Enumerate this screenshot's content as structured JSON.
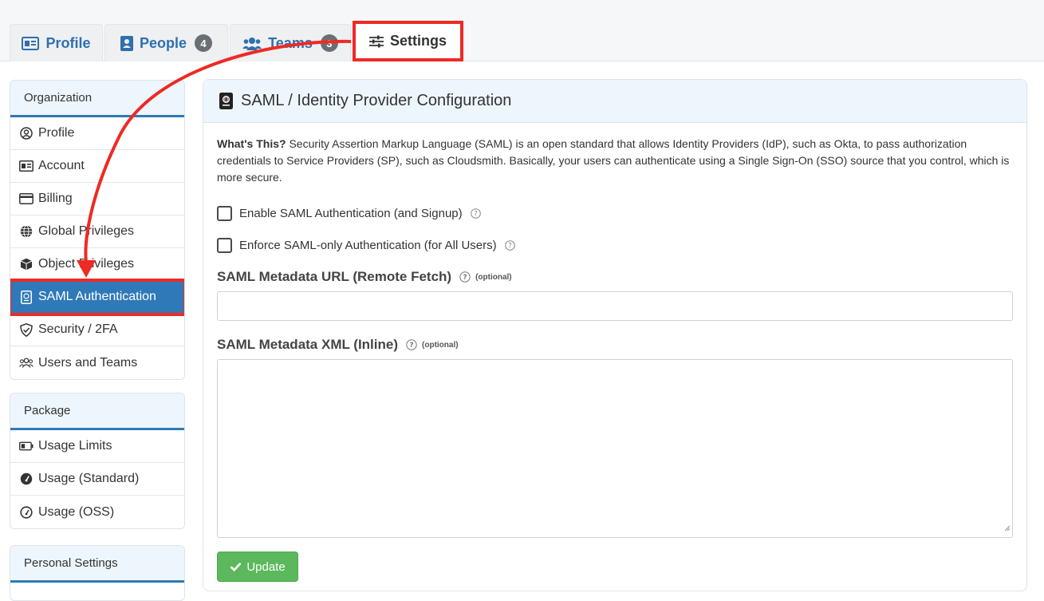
{
  "tabs": [
    {
      "label": "Profile",
      "icon": "id-card-icon"
    },
    {
      "label": "People",
      "icon": "address-book-icon",
      "badge": "4"
    },
    {
      "label": "Teams",
      "icon": "users-icon",
      "badge": "3"
    },
    {
      "label": "Settings",
      "icon": "sliders-icon"
    }
  ],
  "sidebar": {
    "organization": {
      "title": "Organization",
      "items": [
        {
          "label": "Profile",
          "icon": "user-circle-icon"
        },
        {
          "label": "Account",
          "icon": "id-card-icon"
        },
        {
          "label": "Billing",
          "icon": "credit-card-icon"
        },
        {
          "label": "Global Privileges",
          "icon": "globe-icon"
        },
        {
          "label": "Object Privileges",
          "icon": "cube-icon"
        },
        {
          "label": "SAML Authentication",
          "icon": "passport-icon"
        },
        {
          "label": "Security / 2FA",
          "icon": "shield-icon"
        },
        {
          "label": "Users and Teams",
          "icon": "users-icon"
        }
      ]
    },
    "package": {
      "title": "Package",
      "items": [
        {
          "label": "Usage Limits",
          "icon": "battery-icon"
        },
        {
          "label": "Usage (Standard)",
          "icon": "gauge-icon"
        },
        {
          "label": "Usage (OSS)",
          "icon": "gauge-outline-icon"
        }
      ]
    },
    "personal": {
      "title": "Personal Settings"
    }
  },
  "main": {
    "title": "SAML / Identity Provider Configuration",
    "desc_strong": "What's This?",
    "desc_text": " Security Assertion Markup Language (SAML) is an open standard that allows Identity Providers (IdP), such as Okta, to pass authorization credentials to Service Providers (SP), such as Cloudsmith. Basically, your users can authenticate using a Single Sign-On (SSO) source that you control, which is more secure.",
    "checkbox_enable": "Enable SAML Authentication (and Signup)",
    "checkbox_enforce": "Enforce SAML-only Authentication (for All Users)",
    "url_label": "SAML Metadata URL (Remote Fetch)",
    "xml_label": "SAML Metadata XML (Inline)",
    "optional": "(optional)",
    "update_label": "Update"
  },
  "colors": {
    "accent": "#2f79b9",
    "annotation": "#ee2a24",
    "success": "#5cb85c"
  }
}
